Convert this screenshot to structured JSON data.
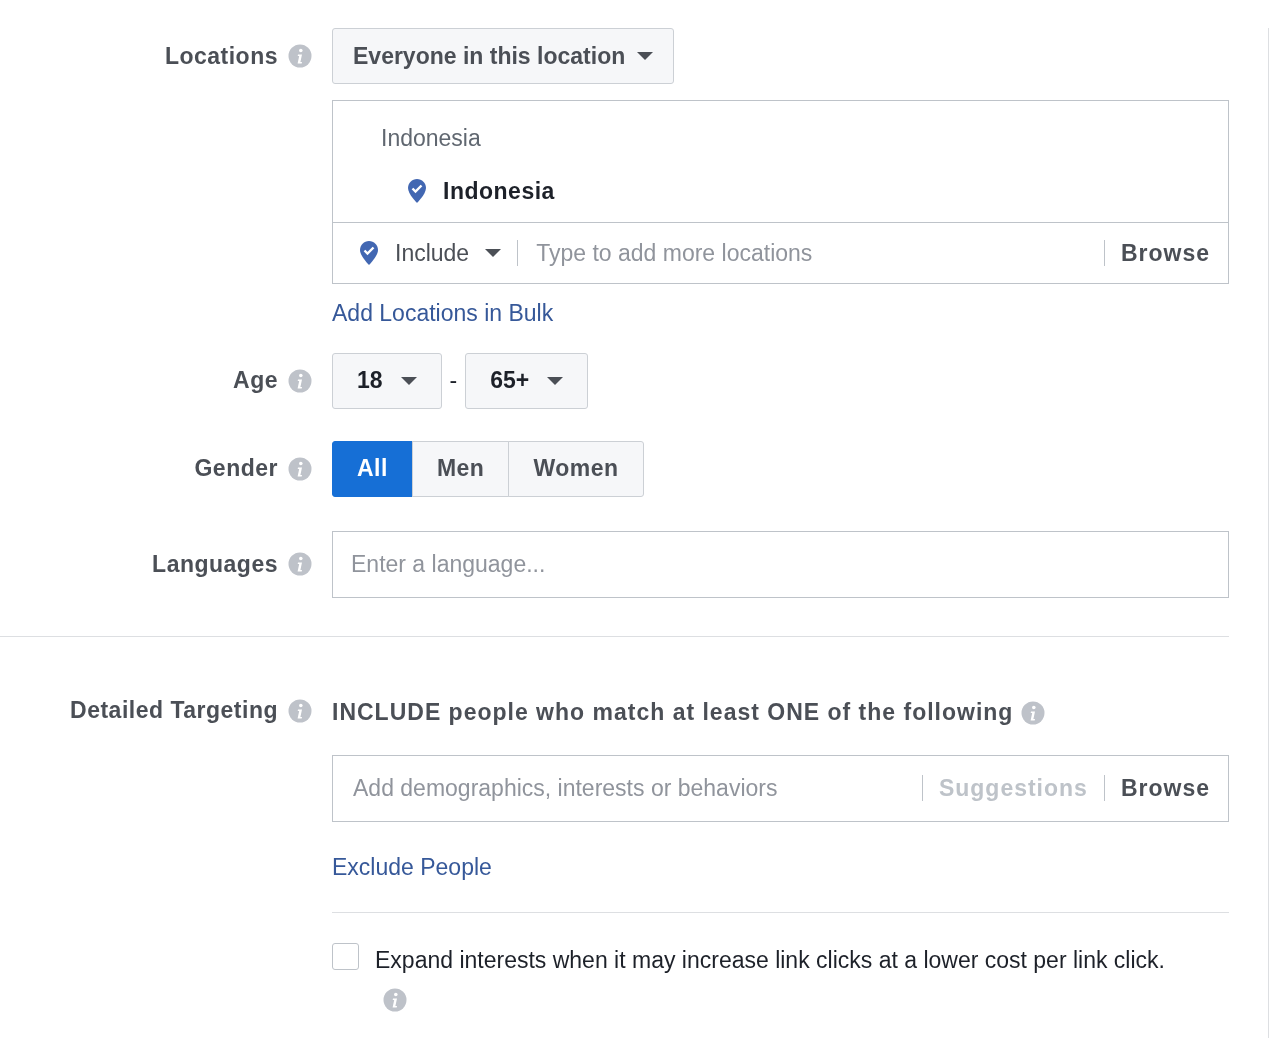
{
  "locations": {
    "label": "Locations",
    "mode": "Everyone in this location",
    "search_text": "Indonesia",
    "selected": [
      {
        "name": "Indonesia"
      }
    ],
    "filter": "Include",
    "placeholder": "Type to add more locations",
    "browse": "Browse",
    "bulk_link": "Add Locations in Bulk"
  },
  "age": {
    "label": "Age",
    "min": "18",
    "separator": "-",
    "max": "65+"
  },
  "gender": {
    "label": "Gender",
    "options": [
      {
        "label": "All",
        "selected": true
      },
      {
        "label": "Men",
        "selected": false
      },
      {
        "label": "Women",
        "selected": false
      }
    ]
  },
  "languages": {
    "label": "Languages",
    "placeholder": "Enter a language..."
  },
  "detailed_targeting": {
    "label": "Detailed Targeting",
    "heading": "INCLUDE people who match at least ONE of the following",
    "placeholder": "Add demographics, interests or behaviors",
    "suggestions": {
      "label": "Suggestions",
      "disabled": true
    },
    "browse": "Browse",
    "exclude_link": "Exclude People"
  },
  "expand_interests": {
    "label": "Expand interests when it may increase link clicks at a lower cost per link click.",
    "checked": false
  }
}
